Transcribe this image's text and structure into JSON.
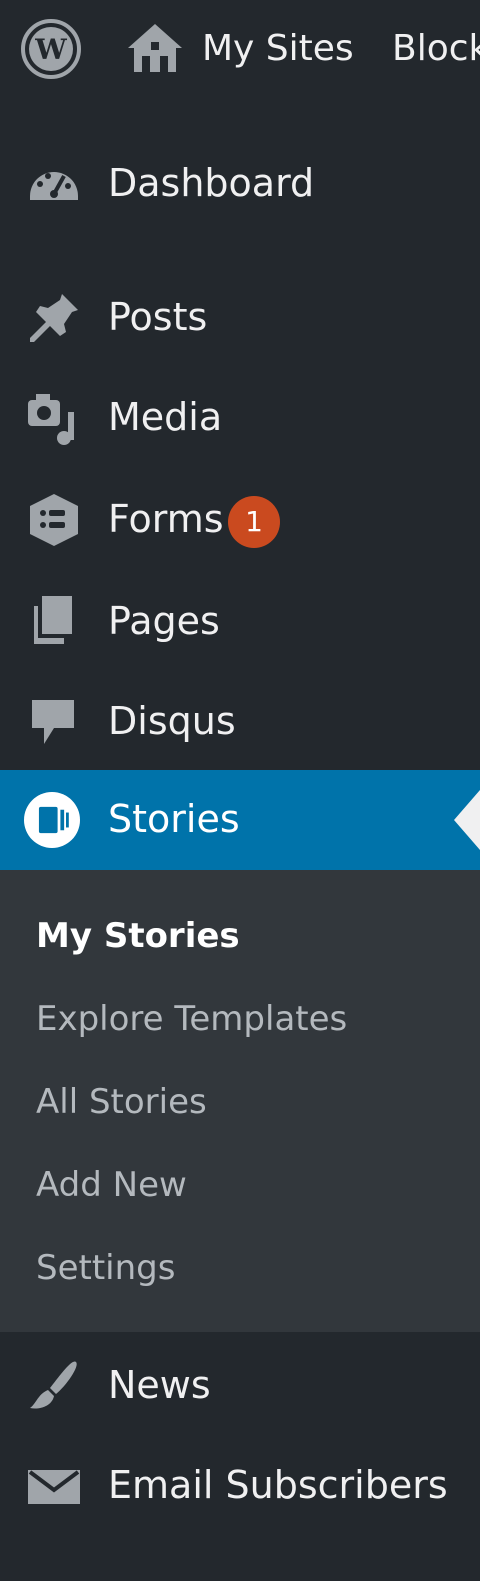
{
  "topbar": {
    "my_sites": "My Sites",
    "next_item": "Block"
  },
  "menu": {
    "dashboard": "Dashboard",
    "posts": "Posts",
    "media": "Media",
    "forms": "Forms",
    "forms_badge": "1",
    "pages": "Pages",
    "disqus": "Disqus",
    "stories": "Stories",
    "news": "News",
    "email_subscribers": "Email Subscribers"
  },
  "stories_submenu": [
    "My Stories",
    "Explore Templates",
    "All Stories",
    "Add New",
    "Settings"
  ],
  "colors": {
    "background": "#23282d",
    "submenu_background": "#32373c",
    "active": "#0073aa",
    "badge": "#ca4a1f",
    "icon": "#a0a5aa"
  }
}
